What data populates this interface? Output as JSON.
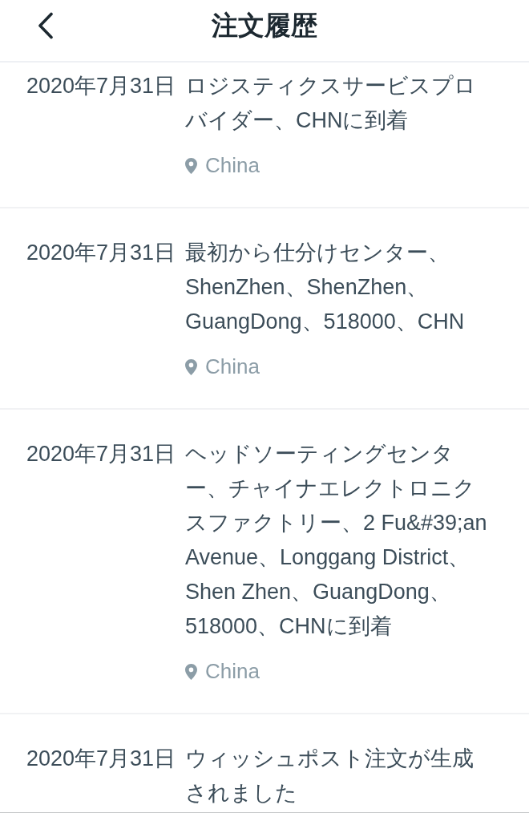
{
  "header": {
    "title": "注文履歴"
  },
  "events": [
    {
      "date": "2020年7月31日",
      "description": "ロジスティクスサービスプロバイダー、CHNに到着",
      "location": "China"
    },
    {
      "date": "2020年7月31日",
      "description": "最初から仕分けセンター、ShenZhen、ShenZhen、GuangDong、518000、CHN",
      "location": "China"
    },
    {
      "date": "2020年7月31日",
      "description": "ヘッドソーティングセンター、チャイナエレクトロニクスファクトリー、2 Fu&#39;an Avenue、Longgang District、Shen Zhen、GuangDong、518000、CHNに到着",
      "location": "China"
    },
    {
      "date": "2020年7月31日",
      "description": "ウィッシュポスト注文が生成されました"
    }
  ]
}
